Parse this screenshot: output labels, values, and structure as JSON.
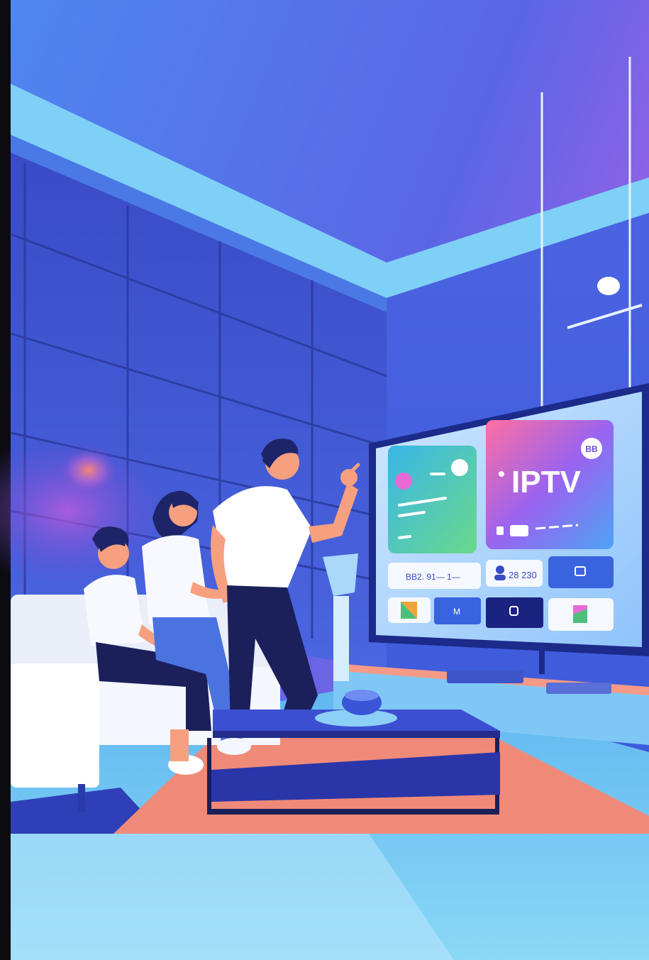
{
  "tv_screen": {
    "logo_text": "IPTV",
    "badge_text": "ВВ",
    "row1_left_text": "ВВ2. 91— 1—",
    "row1_mid_text": "28 230",
    "tile_m_text": "M"
  },
  "colors": {
    "sky_top": "#5f77f0",
    "sky_purple": "#b45fe6",
    "wall_blue": "#3c55d8",
    "floor_light": "#69c8f2",
    "rug_salmon": "#f08a78",
    "sofa_white": "#f2f5fb",
    "tv_frame": "#1c2a8a"
  }
}
